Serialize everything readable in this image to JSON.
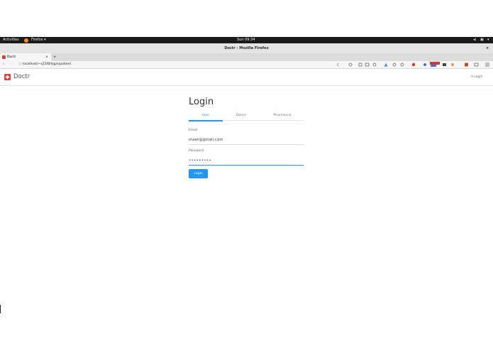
{
  "os": {
    "activities": "Activities",
    "app_menu": "Firefox ▾",
    "clock": "Sun 09:34"
  },
  "window": {
    "title": "Doctr - Mozilla Firefox"
  },
  "browser": {
    "tab_title": "Doctr",
    "url": "localhost/~s23/B/login/patient"
  },
  "app": {
    "brand": "Doctr",
    "login_link": "Login"
  },
  "form": {
    "title": "Login",
    "tabs": [
      "User",
      "Doctor",
      "Pharmacist"
    ],
    "active_tab": "User",
    "email_label": "Email",
    "email_value": "meet@gmail.com",
    "password_label": "Password",
    "password_value": "•••••••••",
    "submit_label": "Login"
  },
  "colors": {
    "accent": "#2196f3",
    "brand": "#e03a3a"
  }
}
